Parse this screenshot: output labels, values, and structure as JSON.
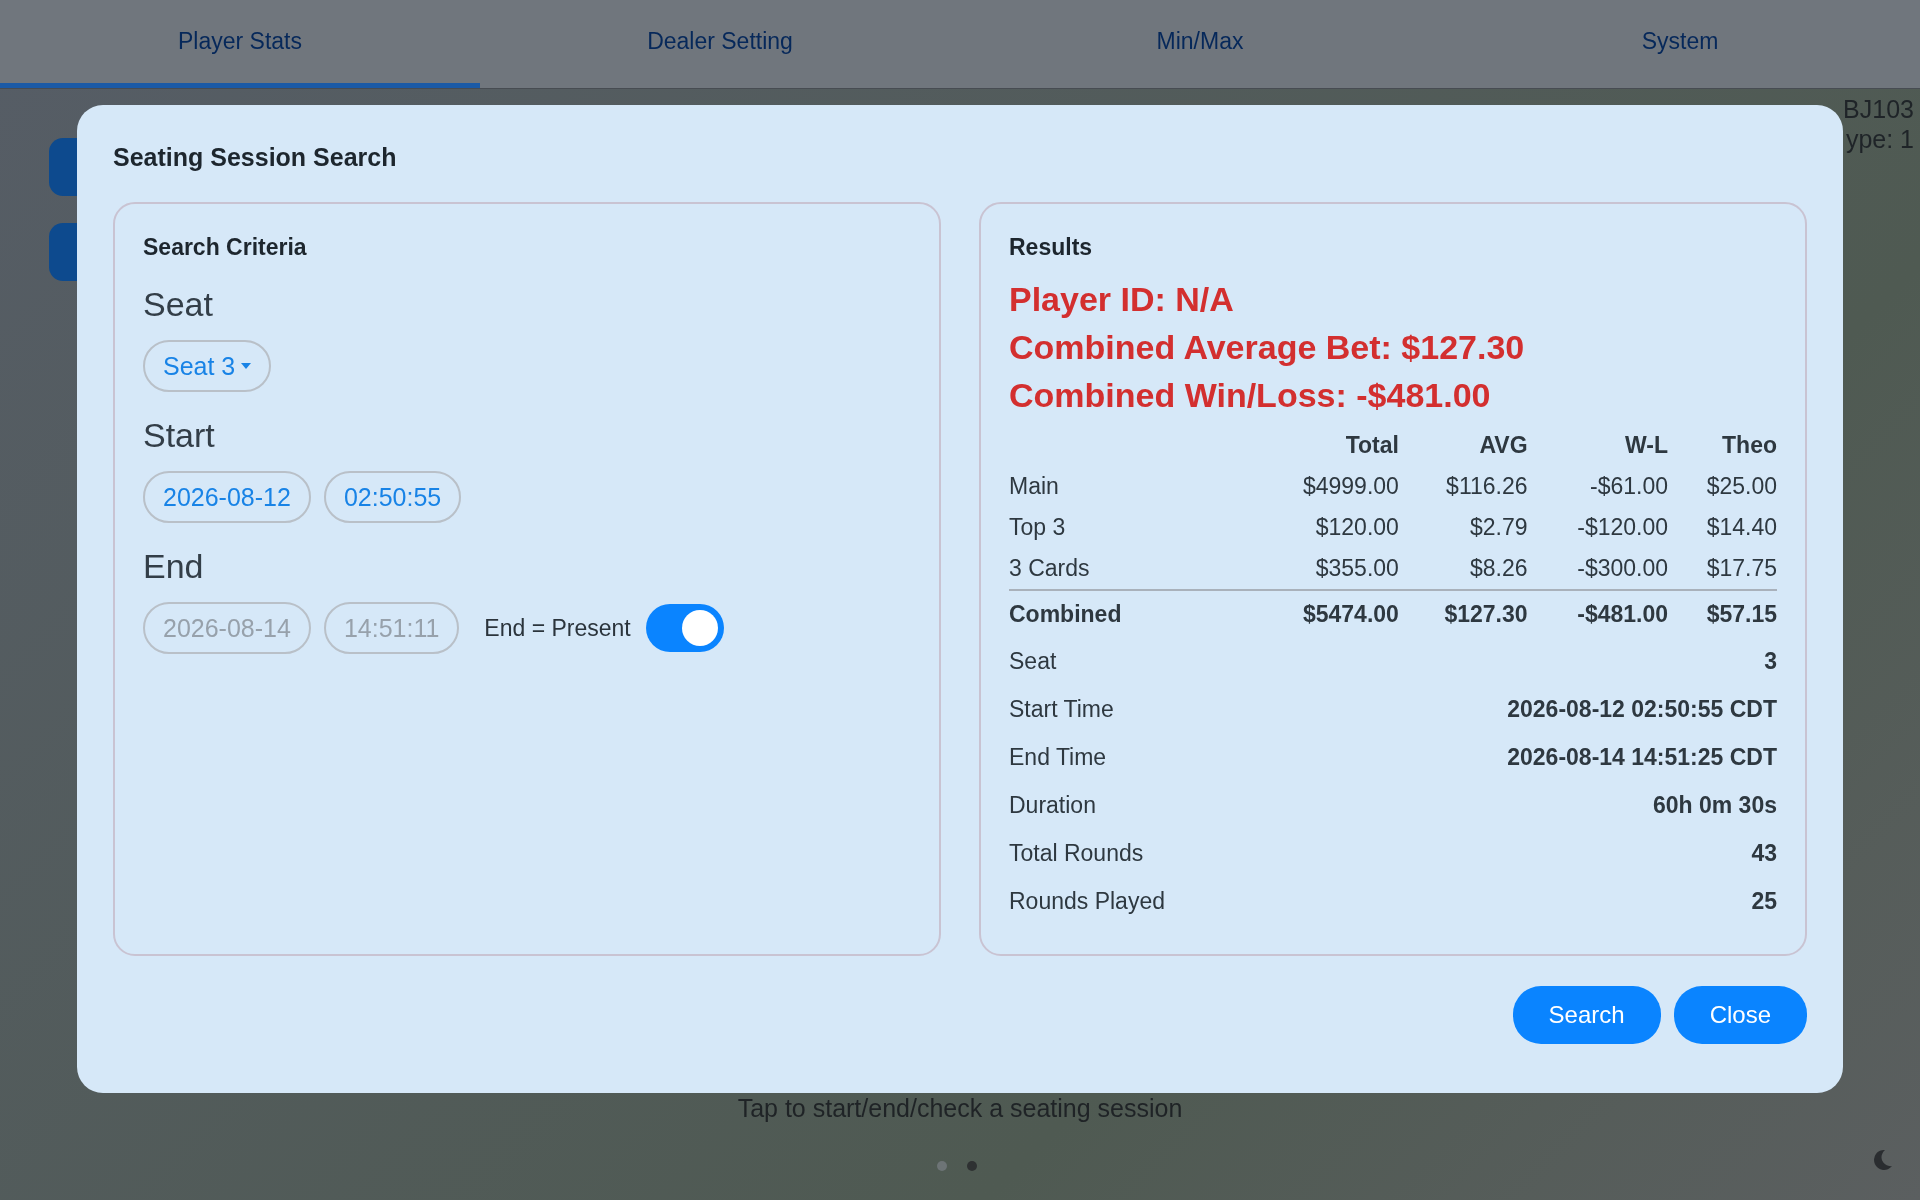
{
  "tabs": [
    {
      "label": "Player Stats",
      "selected": true
    },
    {
      "label": "Dealer Setting",
      "selected": false
    },
    {
      "label": "Min/Max",
      "selected": false
    },
    {
      "label": "System",
      "selected": false
    }
  ],
  "table_info": [
    "BJ103",
    "ype: 1"
  ],
  "hint": "Tap to start/end/check a seating session",
  "pager": [
    {
      "selected": false
    },
    {
      "selected": true
    }
  ],
  "dialog": {
    "title": "Seating Session Search",
    "criteria": {
      "title": "Search Criteria",
      "seat": {
        "label": "Seat",
        "value": "Seat 3"
      },
      "ranges": [
        {
          "label": "Start",
          "date": "2026-08-12",
          "time": "02:50:55",
          "disabled": false
        },
        {
          "label": "End",
          "date": "2026-08-14",
          "time": "14:51:11",
          "disabled": true
        }
      ],
      "end_present": {
        "label": "End = Present",
        "on": true
      }
    },
    "results": {
      "title": "Results",
      "highlights": [
        "Player ID: N/A",
        "Combined Average Bet: $127.30",
        "Combined Win/Loss: -$481.00"
      ],
      "columns": [
        "Total",
        "AVG",
        "W-L",
        "Theo"
      ],
      "rows": [
        {
          "label": "Main",
          "values": [
            "$4999.00",
            "$116.26",
            "-$61.00",
            "$25.00"
          ]
        },
        {
          "label": "Top 3",
          "values": [
            "$120.00",
            "$2.79",
            "-$120.00",
            "$14.40"
          ]
        },
        {
          "label": "3 Cards",
          "values": [
            "$355.00",
            "$8.26",
            "-$300.00",
            "$17.75"
          ]
        }
      ],
      "total": {
        "label": "Combined",
        "values": [
          "$5474.00",
          "$127.30",
          "-$481.00",
          "$57.15"
        ]
      },
      "details": [
        {
          "label": "Seat",
          "value": "3"
        },
        {
          "label": "Start Time",
          "value": "2026-08-12 02:50:55 CDT"
        },
        {
          "label": "End Time",
          "value": "2026-08-14 14:51:25 CDT"
        },
        {
          "label": "Duration",
          "value": "60h 0m 30s"
        },
        {
          "label": "Total Rounds",
          "value": "43"
        },
        {
          "label": "Rounds Played",
          "value": "25"
        }
      ]
    },
    "buttons": [
      "Search",
      "Close"
    ]
  }
}
